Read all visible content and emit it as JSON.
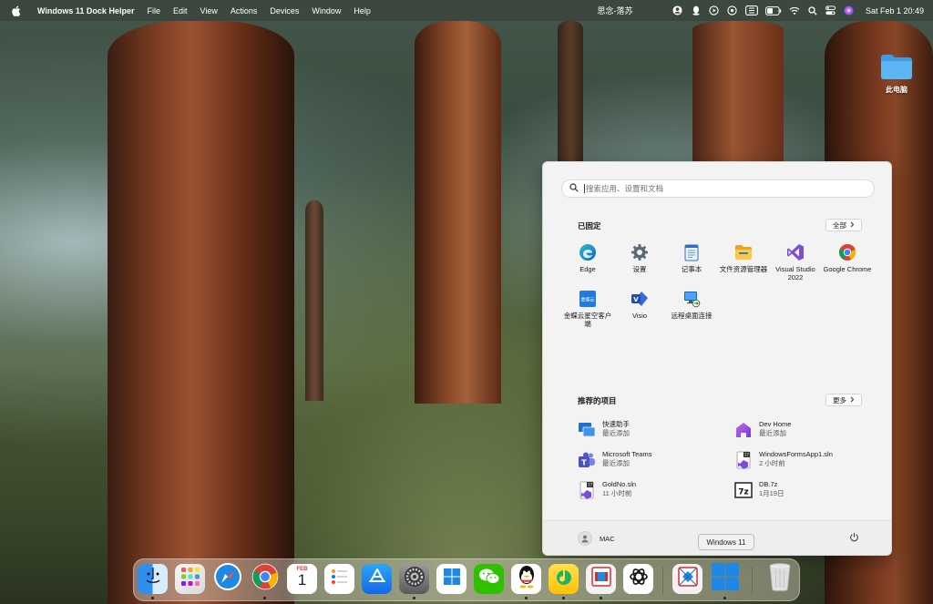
{
  "menubar": {
    "app_name": "Windows 11 Dock Helper",
    "menus": [
      "File",
      "Edit",
      "View",
      "Actions",
      "Devices",
      "Window",
      "Help"
    ],
    "center_title": "思念-落苏",
    "clock": "Sat Feb 1  20:49"
  },
  "desktop": {
    "icons": [
      {
        "label": "此电脑",
        "icon": "folder-icon"
      }
    ]
  },
  "start_menu": {
    "search_placeholder": "搜索应用、设置和文档",
    "pinned": {
      "title": "已固定",
      "all_button": "全部",
      "apps": [
        {
          "label": "Edge",
          "icon": "edge-icon"
        },
        {
          "label": "设置",
          "icon": "settings-gear-icon"
        },
        {
          "label": "记事本",
          "icon": "notepad-icon"
        },
        {
          "label": "文件资源管理器",
          "icon": "file-explorer-icon"
        },
        {
          "label": "Visual Studio 2022",
          "icon": "visual-studio-icon"
        },
        {
          "label": "Google Chrome",
          "icon": "chrome-icon"
        },
        {
          "label": "金蝶云星空客户端",
          "icon": "kingdee-icon"
        },
        {
          "label": "Visio",
          "icon": "visio-icon"
        },
        {
          "label": "远程桌面连接",
          "icon": "remote-desktop-icon"
        }
      ]
    },
    "recommended": {
      "title": "推荐的项目",
      "more_button": "更多",
      "items": [
        {
          "name": "快速助手",
          "detail": "最近添加",
          "icon": "quick-assist-icon"
        },
        {
          "name": "Dev Home",
          "detail": "最近添加",
          "icon": "dev-home-icon"
        },
        {
          "name": "Microsoft Teams",
          "detail": "最近添加",
          "icon": "teams-icon"
        },
        {
          "name": "WindowsFormsApp1.sln",
          "detail": "2 小时前",
          "icon": "vs-solution-icon"
        },
        {
          "name": "GoldNo.sln",
          "detail": "11 小时前",
          "icon": "vs-solution-icon"
        },
        {
          "name": "DB.7z",
          "detail": "1月19日",
          "icon": "7zip-archive-icon"
        }
      ]
    },
    "user_name": "MAC"
  },
  "tooltip": "Windows 11",
  "dock": {
    "apps": [
      {
        "name": "Finder",
        "icon": "finder-icon",
        "running": true
      },
      {
        "name": "Launchpad",
        "icon": "launchpad-icon",
        "running": false
      },
      {
        "name": "Safari",
        "icon": "safari-icon",
        "running": false
      },
      {
        "name": "Chrome",
        "icon": "chrome-icon",
        "running": true
      },
      {
        "name": "Calendar",
        "icon": "calendar-icon",
        "running": false,
        "month": "FEB",
        "day": "1"
      },
      {
        "name": "Reminders",
        "icon": "reminders-icon",
        "running": false
      },
      {
        "name": "App Store",
        "icon": "app-store-icon",
        "running": false
      },
      {
        "name": "System Settings",
        "icon": "system-settings-icon",
        "running": true
      },
      {
        "name": "Windows 11 Dock Helper",
        "icon": "windows-icon",
        "running": false
      },
      {
        "name": "WeChat",
        "icon": "wechat-icon",
        "running": false
      },
      {
        "name": "QQ",
        "icon": "qq-icon",
        "running": true
      },
      {
        "name": "QQ Music",
        "icon": "qq-music-icon",
        "running": true
      },
      {
        "name": "Parallels Desktop",
        "icon": "parallels-icon",
        "running": true
      },
      {
        "name": "ChatGPT",
        "icon": "chatgpt-icon",
        "running": false
      },
      {
        "name": "Remote Desktop",
        "icon": "remote-desktop-icon",
        "running": false
      },
      {
        "name": "Windows 11",
        "icon": "windows-start-icon",
        "running": true
      },
      {
        "name": "Trash",
        "icon": "trash-icon",
        "running": false
      }
    ]
  },
  "colors": {
    "accent_blue": "#1a73e8",
    "windows_blue": "#1e88e5"
  }
}
